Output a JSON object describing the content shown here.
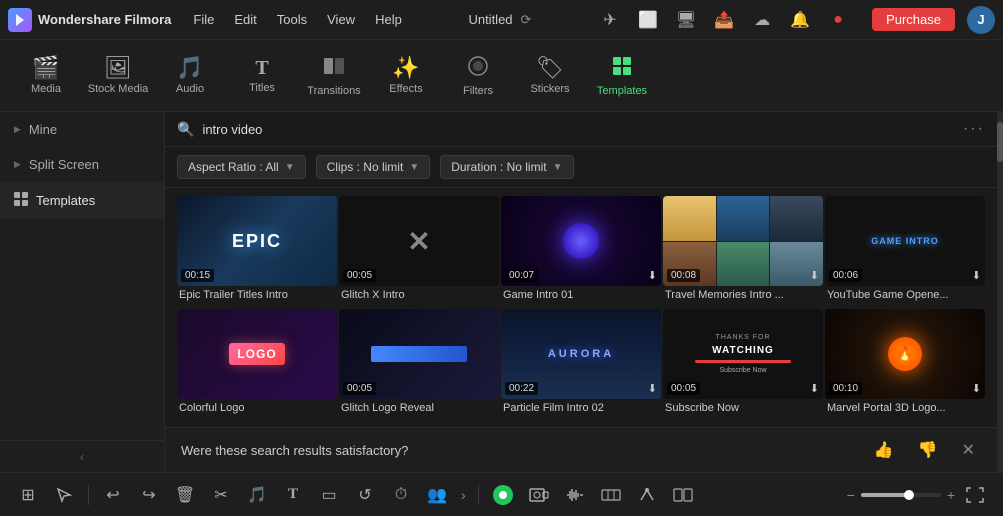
{
  "app": {
    "name": "Wondershare Filmora",
    "project": "Untitled"
  },
  "nav": {
    "menu": [
      "File",
      "Edit",
      "Tools",
      "View",
      "Help"
    ],
    "purchase": "Purchase",
    "avatar_initial": "J"
  },
  "toolbar": {
    "items": [
      {
        "id": "media",
        "label": "Media",
        "icon": "🎬"
      },
      {
        "id": "stock-media",
        "label": "Stock Media",
        "icon": "📷"
      },
      {
        "id": "audio",
        "label": "Audio",
        "icon": "🎵"
      },
      {
        "id": "titles",
        "label": "Titles",
        "icon": "T"
      },
      {
        "id": "transitions",
        "label": "Transitions",
        "icon": "▶"
      },
      {
        "id": "effects",
        "label": "Effects",
        "icon": "✨"
      },
      {
        "id": "filters",
        "label": "Filters",
        "icon": "🔲"
      },
      {
        "id": "stickers",
        "label": "Stickers",
        "icon": "🔶"
      },
      {
        "id": "templates",
        "label": "Templates",
        "icon": "⊞"
      }
    ]
  },
  "sidebar": {
    "items": [
      {
        "id": "mine",
        "label": "Mine",
        "has_arrow": true
      },
      {
        "id": "split-screen",
        "label": "Split Screen",
        "has_arrow": true
      },
      {
        "id": "templates",
        "label": "Templates",
        "has_icon": true
      }
    ]
  },
  "search": {
    "placeholder": "intro video",
    "value": "intro video"
  },
  "filters": {
    "aspect_ratio": {
      "label": "Aspect Ratio : All"
    },
    "clips": {
      "label": "Clips : No limit"
    },
    "duration": {
      "label": "Duration : No limit"
    }
  },
  "templates": [
    {
      "id": 1,
      "name": "Epic Trailer Titles Intro",
      "duration": "00:15",
      "type": "epic",
      "downloadable": false
    },
    {
      "id": 2,
      "name": "Glitch X Intro",
      "duration": "00:05",
      "type": "glitchx",
      "downloadable": false
    },
    {
      "id": 3,
      "name": "Game Intro 01",
      "duration": "00:07",
      "type": "game",
      "downloadable": true
    },
    {
      "id": 4,
      "name": "Travel Memories Intro ...",
      "duration": "00:08",
      "type": "travel",
      "downloadable": true
    },
    {
      "id": 5,
      "name": "YouTube Game Opene...",
      "duration": "00:06",
      "type": "youtube",
      "downloadable": true
    },
    {
      "id": 6,
      "name": "Colorful Logo",
      "duration": "",
      "type": "logo",
      "downloadable": false
    },
    {
      "id": 7,
      "name": "Glitch Logo Reveal",
      "duration": "00:05",
      "type": "glitch-logo",
      "downloadable": false
    },
    {
      "id": 8,
      "name": "Particle Film Intro 02",
      "duration": "00:22",
      "type": "aurora",
      "downloadable": true
    },
    {
      "id": 9,
      "name": "Subscribe Now",
      "duration": "00:05",
      "type": "watching",
      "downloadable": true
    },
    {
      "id": 10,
      "name": "Marvel Portal 3D Logo...",
      "duration": "00:10",
      "type": "marvel",
      "downloadable": true
    }
  ],
  "satisfaction": {
    "question": "Were these search results satisfactory?"
  },
  "bottom_toolbar": {
    "icons": [
      "⊞",
      "↩",
      "✂",
      "📋",
      "T",
      "▭",
      "↺"
    ],
    "more": "›",
    "plus": "+"
  }
}
